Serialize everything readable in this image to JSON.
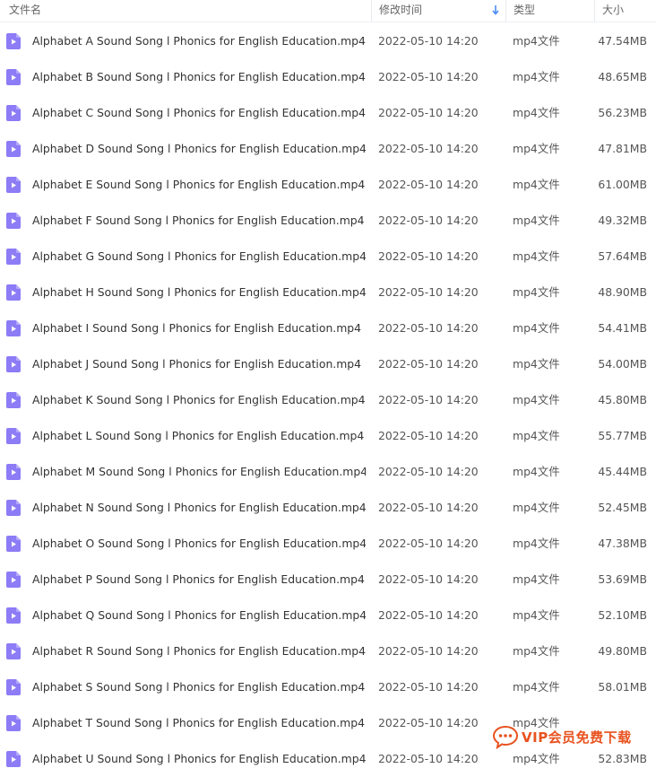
{
  "header": {
    "name_label": "文件名",
    "date_label": "修改时间",
    "type_label": "类型",
    "size_label": "大小",
    "sort_icon": "arrow-down-icon"
  },
  "colors": {
    "accent": "#4a8cf7",
    "file_icon": "#8c7cf6",
    "watermark": "#e8521f"
  },
  "files": [
    {
      "name": "Alphabet A Sound Song l Phonics for English Education.mp4",
      "date": "2022-05-10 14:20",
      "type": "mp4文件",
      "size": "47.54MB"
    },
    {
      "name": "Alphabet B Sound Song l Phonics for English Education.mp4",
      "date": "2022-05-10 14:20",
      "type": "mp4文件",
      "size": "48.65MB"
    },
    {
      "name": "Alphabet C Sound Song l Phonics for English Education.mp4",
      "date": "2022-05-10 14:20",
      "type": "mp4文件",
      "size": "56.23MB"
    },
    {
      "name": "Alphabet D Sound Song l Phonics for English Education.mp4",
      "date": "2022-05-10 14:20",
      "type": "mp4文件",
      "size": "47.81MB"
    },
    {
      "name": "Alphabet E Sound Song l Phonics for English Education.mp4",
      "date": "2022-05-10 14:20",
      "type": "mp4文件",
      "size": "61.00MB"
    },
    {
      "name": "Alphabet F Sound Song l Phonics for English Education.mp4",
      "date": "2022-05-10 14:20",
      "type": "mp4文件",
      "size": "49.32MB"
    },
    {
      "name": "Alphabet G Sound Song l Phonics for English Education.mp4",
      "date": "2022-05-10 14:20",
      "type": "mp4文件",
      "size": "57.64MB"
    },
    {
      "name": "Alphabet H Sound Song l Phonics for English Education.mp4",
      "date": "2022-05-10 14:20",
      "type": "mp4文件",
      "size": "48.90MB"
    },
    {
      "name": "Alphabet I Sound Song l Phonics for English Education.mp4",
      "date": "2022-05-10 14:20",
      "type": "mp4文件",
      "size": "54.41MB"
    },
    {
      "name": "Alphabet J Sound Song l Phonics for English Education.mp4",
      "date": "2022-05-10 14:20",
      "type": "mp4文件",
      "size": "54.00MB"
    },
    {
      "name": "Alphabet K Sound Song l Phonics for English Education.mp4",
      "date": "2022-05-10 14:20",
      "type": "mp4文件",
      "size": "45.80MB"
    },
    {
      "name": "Alphabet L Sound Song l Phonics for English Education.mp4",
      "date": "2022-05-10 14:20",
      "type": "mp4文件",
      "size": "55.77MB"
    },
    {
      "name": "Alphabet M Sound Song l Phonics for English Education.mp4",
      "date": "2022-05-10 14:20",
      "type": "mp4文件",
      "size": "45.44MB"
    },
    {
      "name": "Alphabet N Sound Song l Phonics for English Education.mp4",
      "date": "2022-05-10 14:20",
      "type": "mp4文件",
      "size": "52.45MB"
    },
    {
      "name": "Alphabet O Sound Song l Phonics for English Education.mp4",
      "date": "2022-05-10 14:20",
      "type": "mp4文件",
      "size": "47.38MB"
    },
    {
      "name": "Alphabet P Sound Song l Phonics for English Education.mp4",
      "date": "2022-05-10 14:20",
      "type": "mp4文件",
      "size": "53.69MB"
    },
    {
      "name": "Alphabet Q Sound Song l Phonics for English Education.mp4",
      "date": "2022-05-10 14:20",
      "type": "mp4文件",
      "size": "52.10MB"
    },
    {
      "name": "Alphabet R Sound Song l Phonics for English Education.mp4",
      "date": "2022-05-10 14:20",
      "type": "mp4文件",
      "size": "49.80MB"
    },
    {
      "name": "Alphabet S Sound Song l Phonics for English Education.mp4",
      "date": "2022-05-10 14:20",
      "type": "mp4文件",
      "size": "58.01MB"
    },
    {
      "name": "Alphabet T Sound Song l Phonics for English Education.mp4",
      "date": "2022-05-10 14:20",
      "type": "mp4文件",
      "size": ""
    },
    {
      "name": "Alphabet U Sound Song l Phonics for English Education.mp4",
      "date": "2022-05-10 14:20",
      "type": "mp4文件",
      "size": "52.83MB"
    }
  ],
  "watermark": {
    "icon": "chat-bubble-icon",
    "text": "VIP会员免费下载"
  }
}
